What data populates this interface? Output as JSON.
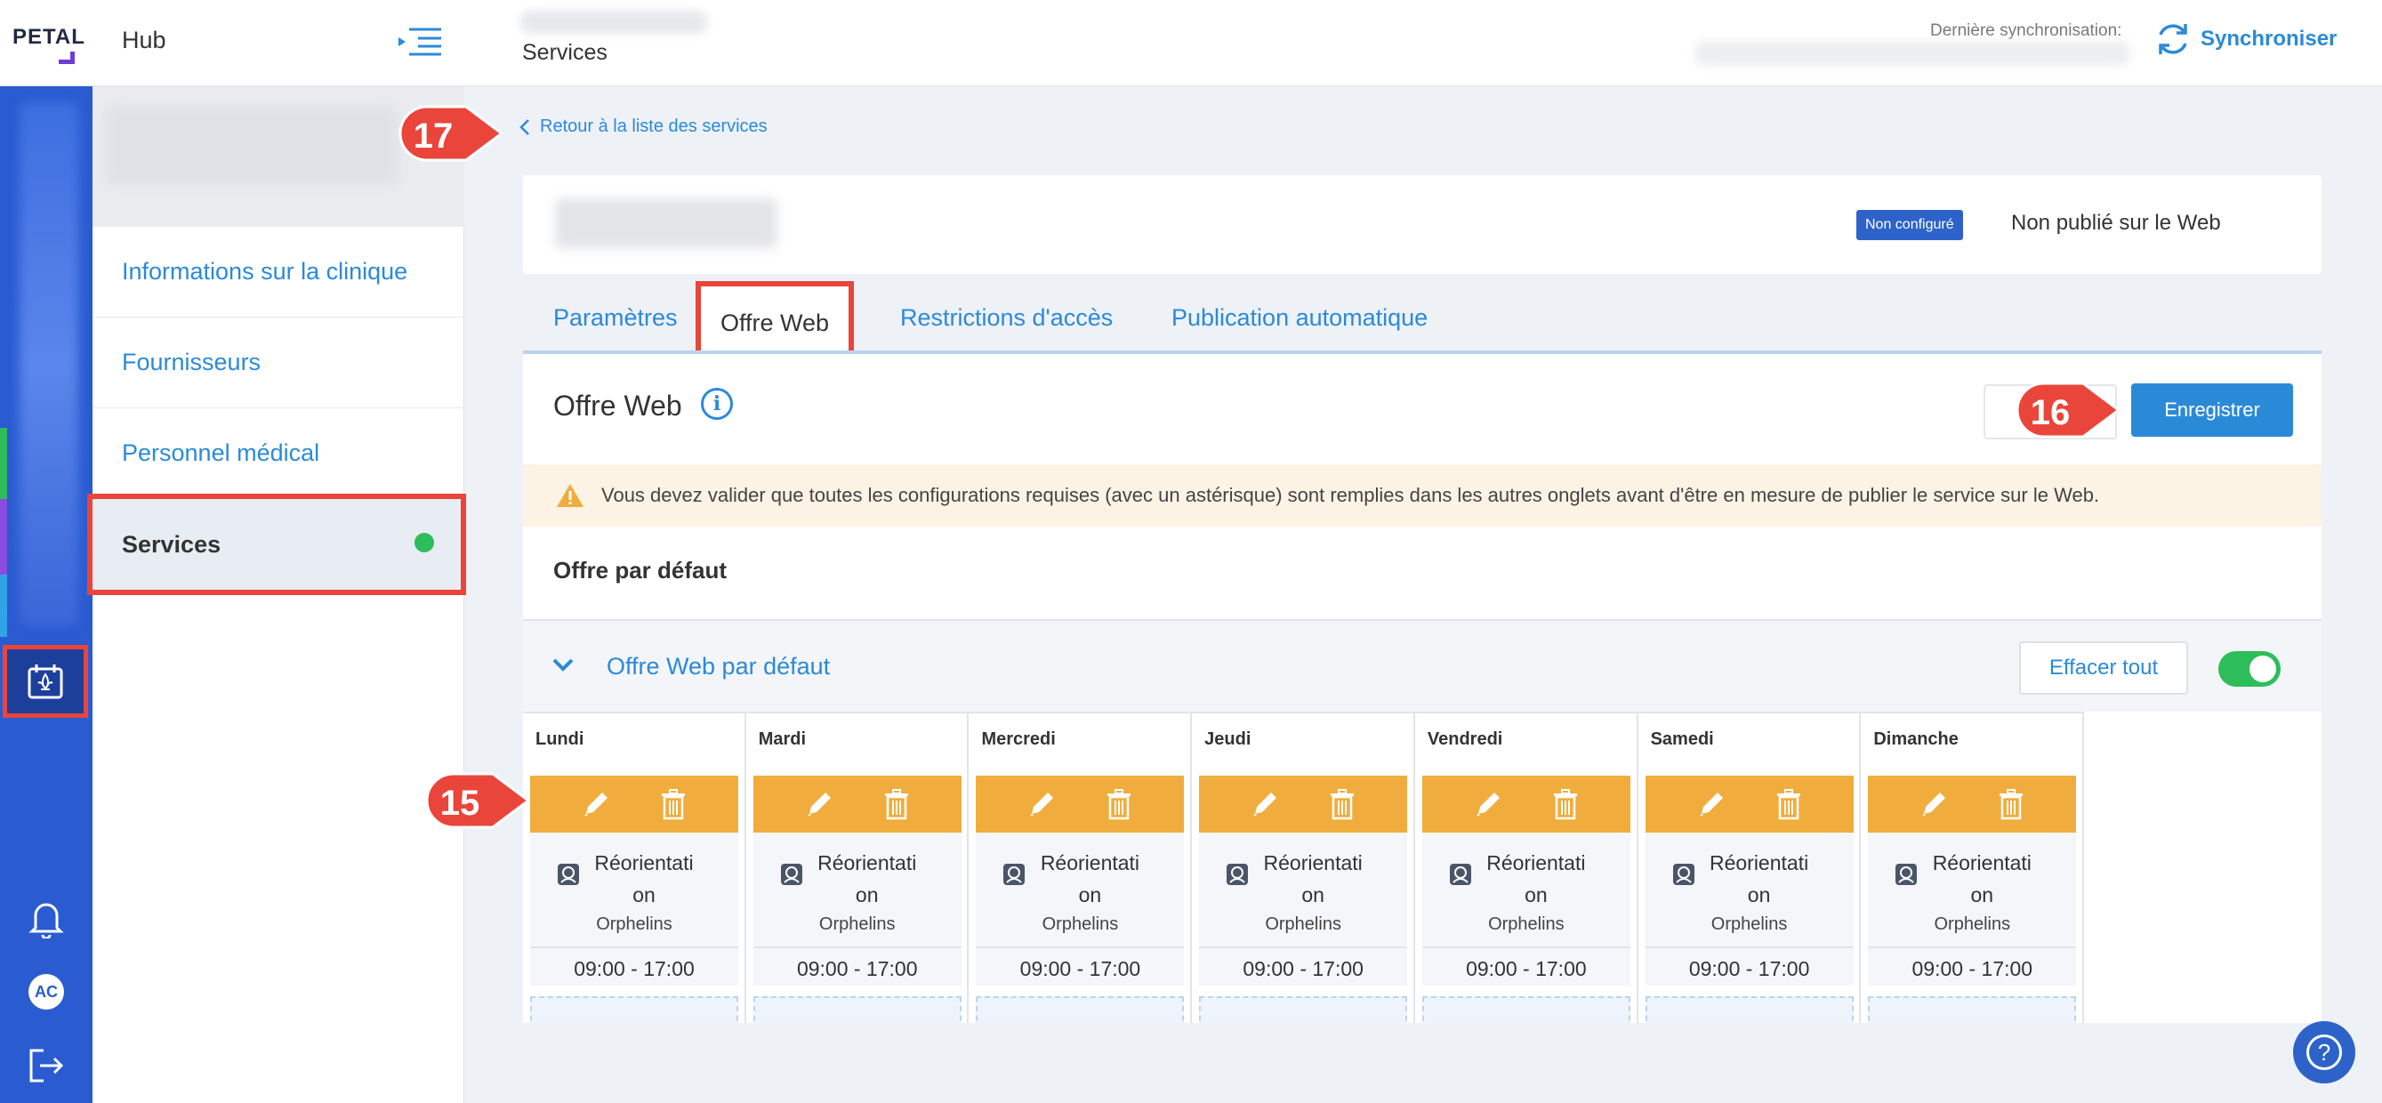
{
  "app": {
    "logo": "PETAL",
    "hub": "Hub",
    "page_title": "Services"
  },
  "sync": {
    "label": "Dernière synchronisation:",
    "button": "Synchroniser"
  },
  "rail": {
    "avatar": "AC"
  },
  "nav": {
    "items": [
      {
        "label": "Informations sur la clinique"
      },
      {
        "label": "Fournisseurs"
      },
      {
        "label": "Personnel médical"
      },
      {
        "label": "Services"
      }
    ]
  },
  "main": {
    "back_link": "Retour à la liste des services",
    "badge": "Non configuré",
    "publish_status": "Non publié sur le Web",
    "tabs": [
      {
        "label": "Paramètres"
      },
      {
        "label": "Offre Web"
      },
      {
        "label": "Restrictions d'accès"
      },
      {
        "label": "Publication automatique"
      }
    ],
    "panel_title": "Offre Web",
    "save_button": "Enregistrer",
    "warning": "Vous devez valider que toutes les configurations requises (avec un astérisque) sont remplies dans les autres onglets avant d'être en mesure de publier le service sur le Web.",
    "section_title": "Offre par défaut",
    "offer_title": "Offre Web par défaut",
    "clear_button": "Effacer tout",
    "toggle_on": true,
    "days": [
      {
        "name": "Lundi",
        "service_line1": "Réorientati",
        "service_line2": "on",
        "subtitle": "Orphelins",
        "time": "09:00 - 17:00"
      },
      {
        "name": "Mardi",
        "service_line1": "Réorientati",
        "service_line2": "on",
        "subtitle": "Orphelins",
        "time": "09:00 - 17:00"
      },
      {
        "name": "Mercredi",
        "service_line1": "Réorientati",
        "service_line2": "on",
        "subtitle": "Orphelins",
        "time": "09:00 - 17:00"
      },
      {
        "name": "Jeudi",
        "service_line1": "Réorientati",
        "service_line2": "on",
        "subtitle": "Orphelins",
        "time": "09:00 - 17:00"
      },
      {
        "name": "Vendredi",
        "service_line1": "Réorientati",
        "service_line2": "on",
        "subtitle": "Orphelins",
        "time": "09:00 - 17:00"
      },
      {
        "name": "Samedi",
        "service_line1": "Réorientati",
        "service_line2": "on",
        "subtitle": "Orphelins",
        "time": "09:00 - 17:00"
      },
      {
        "name": "Dimanche",
        "service_line1": "Réorientati",
        "service_line2": "on",
        "subtitle": "Orphelins",
        "time": "09:00 - 17:00"
      }
    ]
  },
  "callouts": [
    "17",
    "16",
    "15"
  ],
  "icons": {
    "collapse": "menu-collapse-icon",
    "sync": "sync-icon",
    "calendar": "calendar-fleur-de-lis-icon",
    "bell": "bell-icon",
    "logout": "logout-icon",
    "back": "chevron-left-icon",
    "info": "info-icon",
    "warning": "warning-icon",
    "chevron": "chevron-down-icon",
    "edit": "pencil-icon",
    "delete": "trash-icon",
    "service": "service-icon",
    "help": "help-icon"
  },
  "colors": {
    "primary": "#2b8ad8",
    "rail": "#2a5bd1",
    "highlight": "#e9453a",
    "card_bar": "#f0ad3e",
    "success": "#2dbd5a",
    "badge": "#2d62c9"
  }
}
